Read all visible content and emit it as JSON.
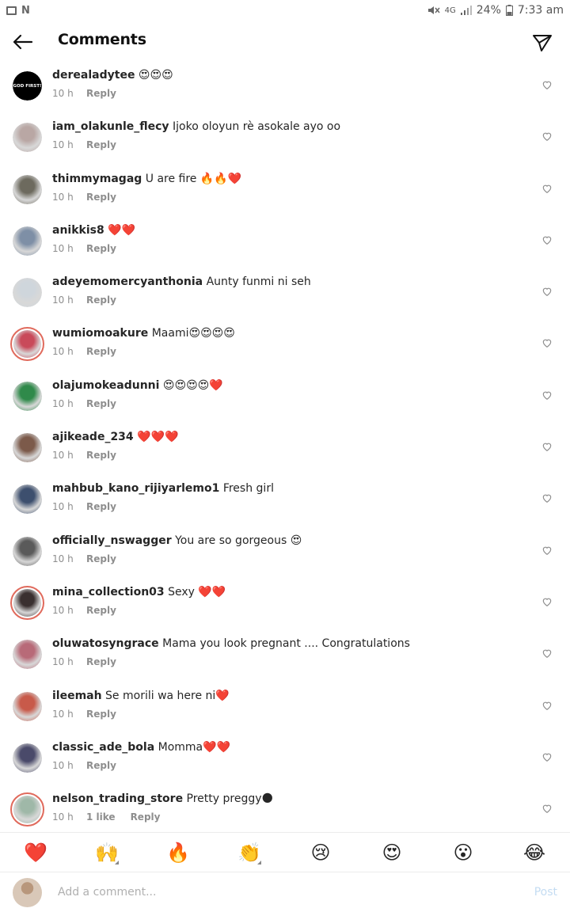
{
  "status_bar": {
    "left_icons": [
      "image-icon",
      "n-icon"
    ],
    "network": "4G",
    "battery": "24%",
    "time": "7:33 am"
  },
  "header": {
    "title": "Comments"
  },
  "comments": [
    {
      "username": "derealadytee",
      "text": "😍😍😍",
      "time": "10 h",
      "likes": "",
      "reply": "Reply",
      "avatar_text": "GOD FIRST!",
      "avatar_color": "#000000",
      "ring": false
    },
    {
      "username": "iam_olakunle_flecy",
      "text": "Ijoko oloyun rè asokale ayo oo",
      "time": "10 h",
      "likes": "",
      "reply": "Reply",
      "avatar_color": "#b9a7a4",
      "ring": false
    },
    {
      "username": "thimmymagag",
      "text": "U are fire 🔥🔥❤️",
      "time": "10 h",
      "likes": "",
      "reply": "Reply",
      "avatar_color": "#6d6a5e",
      "ring": false
    },
    {
      "username": "anikkis8",
      "text": "❤️❤️",
      "time": "10 h",
      "likes": "",
      "reply": "Reply",
      "avatar_color": "#7e8fa6",
      "ring": false
    },
    {
      "username": "adeyemomercyanthonia",
      "text": "Aunty funmi ni seh",
      "time": "10 h",
      "likes": "",
      "reply": "Reply",
      "avatar_color": "#cfd6dc",
      "ring": false
    },
    {
      "username": "wumiomoakure",
      "text": "Maami😍😍😍😍",
      "time": "10 h",
      "likes": "",
      "reply": "Reply",
      "avatar_color": "#c94a5a",
      "ring": true
    },
    {
      "username": "olajumokeadunni",
      "text": "😍😍😍😍❤️",
      "time": "10 h",
      "likes": "",
      "reply": "Reply",
      "avatar_color": "#2f8a4a",
      "ring": false
    },
    {
      "username": "ajikeade_234",
      "text": "❤️❤️❤️",
      "time": "10 h",
      "likes": "",
      "reply": "Reply",
      "avatar_color": "#7c5a4a",
      "ring": false
    },
    {
      "username": "mahbub_kano_rijiyarlemo1",
      "text": "Fresh girl",
      "time": "10 h",
      "likes": "",
      "reply": "Reply",
      "avatar_color": "#3d4f6e",
      "ring": false
    },
    {
      "username": "officially_nswagger",
      "text": "You are so gorgeous 😍",
      "time": "10 h",
      "likes": "",
      "reply": "Reply",
      "avatar_color": "#5a5a5a",
      "ring": false
    },
    {
      "username": "mina_collection03",
      "text": "Sexy ❤️❤️",
      "time": "10 h",
      "likes": "",
      "reply": "Reply",
      "avatar_color": "#3a3030",
      "ring": true
    },
    {
      "username": "oluwatosyngrace",
      "text": "Mama you look pregnant .... Congratulations",
      "time": "10 h",
      "likes": "",
      "reply": "Reply",
      "avatar_color": "#b86a78",
      "ring": false
    },
    {
      "username": "ileemah",
      "text": "Se morili wa here ni❤️",
      "time": "10 h",
      "likes": "",
      "reply": "Reply",
      "avatar_color": "#c85a4a",
      "ring": false
    },
    {
      "username": "classic_ade_bola",
      "text": "Momma❤️❤️",
      "time": "10 h",
      "likes": "",
      "reply": "Reply",
      "avatar_color": "#4a4a6a",
      "ring": false
    },
    {
      "username": "nelson_trading_store",
      "text": "Pretty preggy🌑",
      "time": "10 h",
      "likes": "1 like",
      "reply": "Reply",
      "avatar_color": "#9fb8a8",
      "ring": true
    }
  ],
  "emoji_bar": [
    "❤️",
    "🙌",
    "🔥",
    "👏",
    "😢",
    "😍",
    "😮",
    "😂"
  ],
  "input": {
    "placeholder": "Add a comment...",
    "post_label": "Post"
  }
}
